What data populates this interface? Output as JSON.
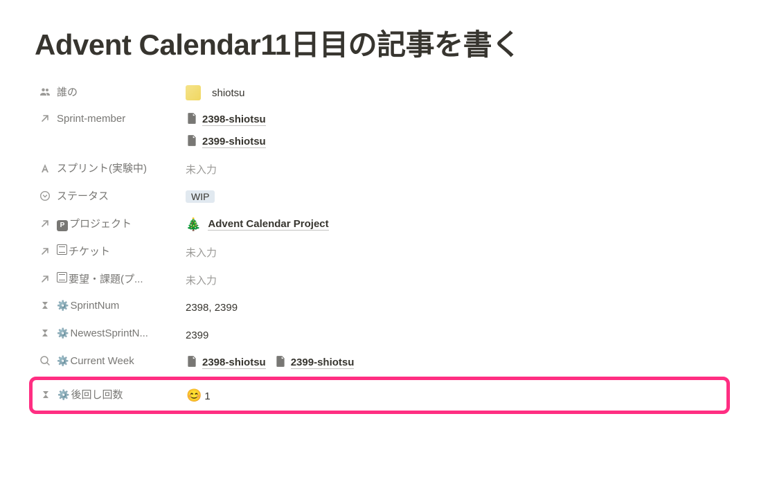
{
  "title": "Advent Calendar11日目の記事を書く",
  "props": {
    "owner": {
      "label": "誰の",
      "user": "shiotsu"
    },
    "sprint_member": {
      "label": "Sprint-member",
      "pages": [
        "2398-shiotsu",
        "2399-shiotsu"
      ]
    },
    "sprint_exp": {
      "label": "スプリント(実験中)",
      "empty": "未入力"
    },
    "status": {
      "label": "ステータス",
      "tag": "WIP"
    },
    "project": {
      "label": "プロジェクト",
      "emoji": "🎄",
      "page": "Advent Calendar Project"
    },
    "ticket": {
      "label": "チケット",
      "empty": "未入力"
    },
    "request": {
      "label": "要望・課題(プ...",
      "empty": "未入力"
    },
    "sprint_num": {
      "label": "SprintNum",
      "value": "2398, 2399"
    },
    "newest_sprint": {
      "label": "NewestSprintN...",
      "value": "2399"
    },
    "current_week": {
      "label": "Current Week",
      "pages": [
        "2398-shiotsu",
        "2399-shiotsu"
      ]
    },
    "postpone": {
      "label": "後回し回数",
      "emoji": "😊",
      "value": "1"
    }
  }
}
